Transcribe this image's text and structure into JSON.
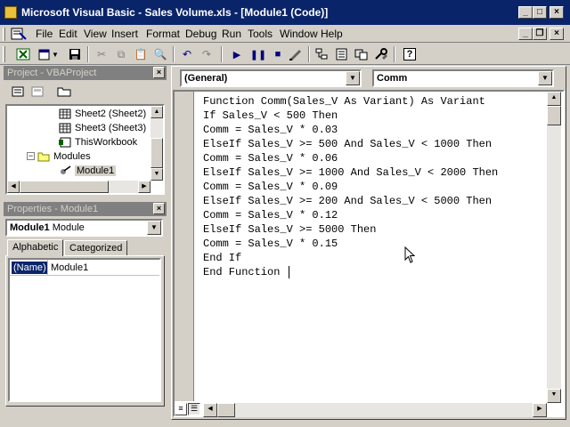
{
  "window": {
    "title": "Microsoft Visual Basic - Sales Volume.xls - [Module1 (Code)]",
    "minimize": "_",
    "maximize": "□",
    "close": "×"
  },
  "menu": [
    "File",
    "Edit",
    "View",
    "Insert",
    "Format",
    "Debug",
    "Run",
    "Tools",
    "Window",
    "Help"
  ],
  "project_panel": {
    "title": "Project - VBAProject",
    "items": [
      "Sheet2 (Sheet2)",
      "Sheet3 (Sheet3)",
      "ThisWorkbook",
      "Modules",
      "Module1"
    ],
    "selected": "Module1"
  },
  "properties_panel": {
    "title": "Properties - Module1",
    "object_name": "Module1",
    "object_type": "Module",
    "tabs": [
      "Alphabetic",
      "Categorized"
    ],
    "active_tab": "Alphabetic",
    "rows": [
      {
        "name": "(Name)",
        "value": "Module1"
      }
    ]
  },
  "code_window": {
    "object_dropdown": "(General)",
    "procedure_dropdown": "Comm",
    "lines": [
      "Function Comm(Sales_V As Variant) As Variant",
      "If Sales_V < 500 Then",
      "Comm = Sales_V * 0.03",
      "ElseIf Sales_V >= 500 And Sales_V < 1000 Then",
      "Comm = Sales_V * 0.06",
      "ElseIf Sales_V >= 1000 And Sales_V < 2000 Then",
      "Comm = Sales_V * 0.09",
      "ElseIf Sales_V >= 200 And Sales_V < 5000 Then",
      "Comm = Sales_V * 0.12",
      "ElseIf Sales_V >= 5000 Then",
      "Comm = Sales_V * 0.15",
      "End If",
      "End Function"
    ]
  }
}
